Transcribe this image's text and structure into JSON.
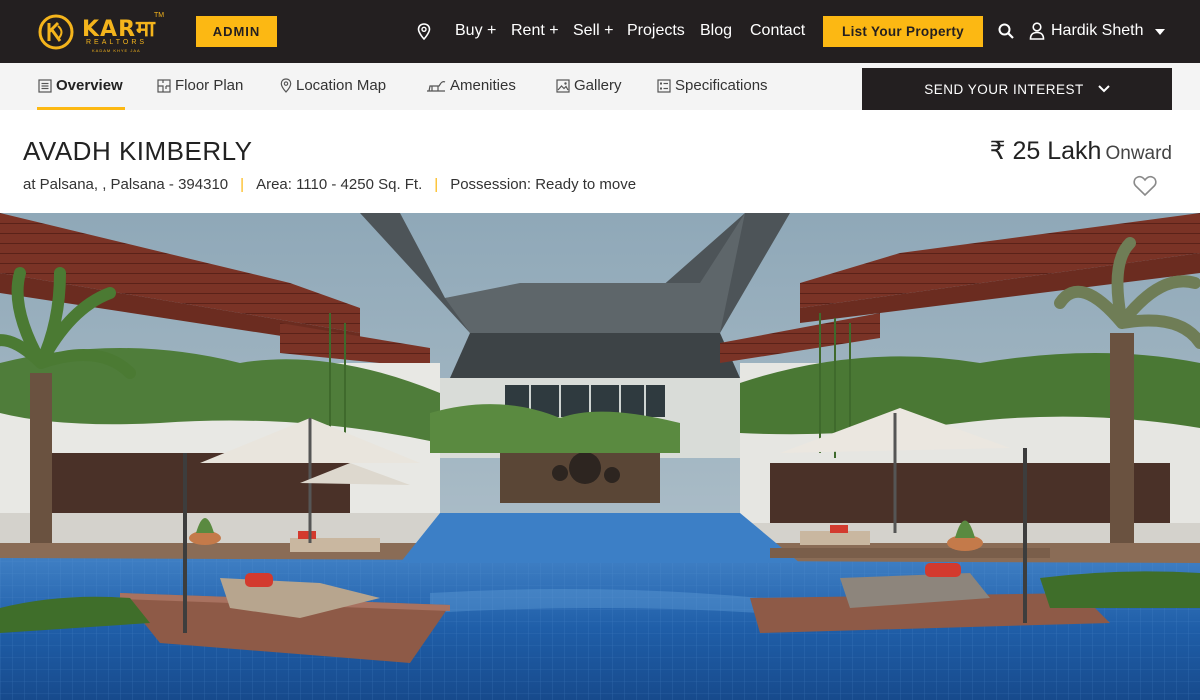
{
  "brand": {
    "name": "KARमा",
    "sub": "REALTORS",
    "tagline": "KADAM KHYE JAA",
    "colors": {
      "accent": "#fcb813",
      "dark": "#231f20"
    }
  },
  "header": {
    "admin_label": "ADMIN",
    "nav": [
      "Buy +",
      "Rent +",
      "Sell +",
      "Projects",
      "Blog",
      "Contact"
    ],
    "list_property_label": "List Your Property",
    "user_name": "Hardik Sheth",
    "icons": [
      "location-pin-icon",
      "search-icon",
      "user-icon",
      "caret-down-icon"
    ]
  },
  "subnav": {
    "tabs": [
      {
        "label": "Overview",
        "icon": "document-icon",
        "active": true
      },
      {
        "label": "Floor Plan",
        "icon": "floor-plan-icon",
        "active": false
      },
      {
        "label": "Location Map",
        "icon": "location-pin-icon",
        "active": false
      },
      {
        "label": "Amenities",
        "icon": "amenities-icon",
        "active": false
      },
      {
        "label": "Gallery",
        "icon": "gallery-icon",
        "active": false
      },
      {
        "label": "Specifications",
        "icon": "specifications-icon",
        "active": false
      }
    ],
    "interest_label": "SEND YOUR INTEREST"
  },
  "property": {
    "title": "AVADH KIMBERLY",
    "location": "at Palsana, , Palsana - 394310",
    "area": "Area: 1110 - 4250 Sq. Ft.",
    "possession": "Possession: Ready to move",
    "price": "₹ 25 Lakh",
    "price_suffix": "Onward"
  },
  "hero": {
    "image": "resort-pool-photo"
  }
}
